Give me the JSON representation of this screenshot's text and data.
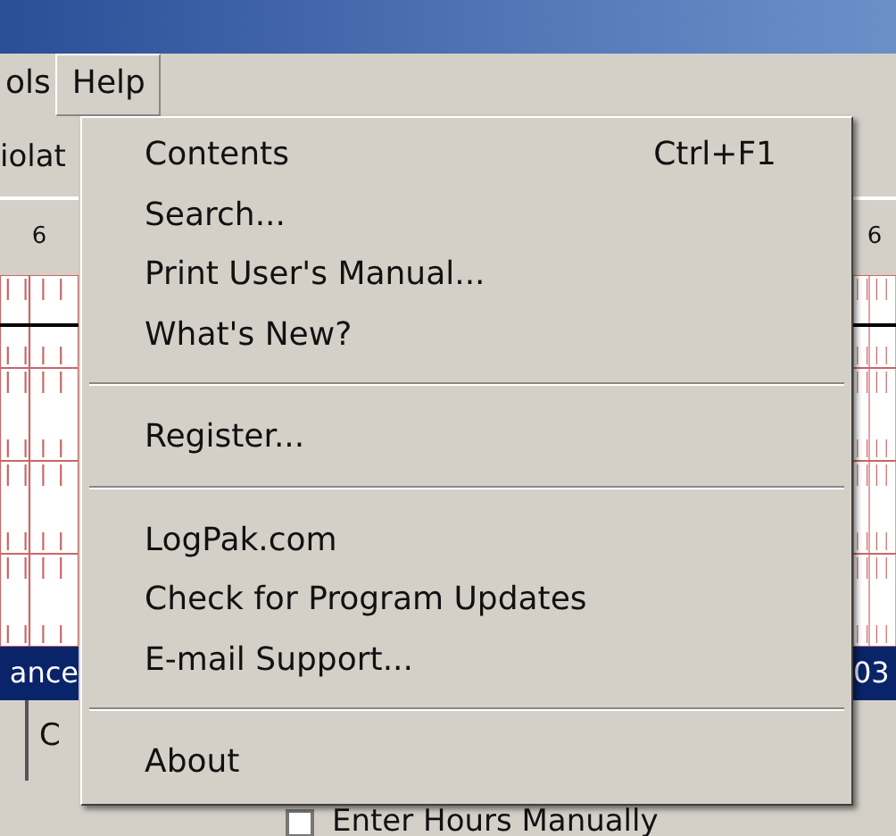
{
  "menu_bar": [
    {
      "label": "ols",
      "selected": false
    },
    {
      "label": "Help",
      "selected": true
    }
  ],
  "left_panel": {
    "tab_label": "iolat",
    "column_label": "6",
    "status_text": "ance",
    "tab_text": "C"
  },
  "right_panel": {
    "column_label": "6",
    "status_text": "03"
  },
  "help_menu": [
    {
      "kind": "item",
      "label": "Contents",
      "shortcut": "Ctrl+F1"
    },
    {
      "kind": "item",
      "label": "Search..."
    },
    {
      "kind": "item",
      "label": "Print User's Manual..."
    },
    {
      "kind": "item",
      "label": "What's New?"
    },
    {
      "kind": "separator"
    },
    {
      "kind": "item",
      "label": "Register..."
    },
    {
      "kind": "separator"
    },
    {
      "kind": "item",
      "label": "LogPak.com"
    },
    {
      "kind": "item",
      "label": "Check for Program Updates"
    },
    {
      "kind": "item",
      "label": "E-mail Support..."
    },
    {
      "kind": "separator"
    },
    {
      "kind": "item",
      "label": "About"
    }
  ],
  "checkbox": {
    "label": "Enter Hours Manually",
    "checked": false
  }
}
